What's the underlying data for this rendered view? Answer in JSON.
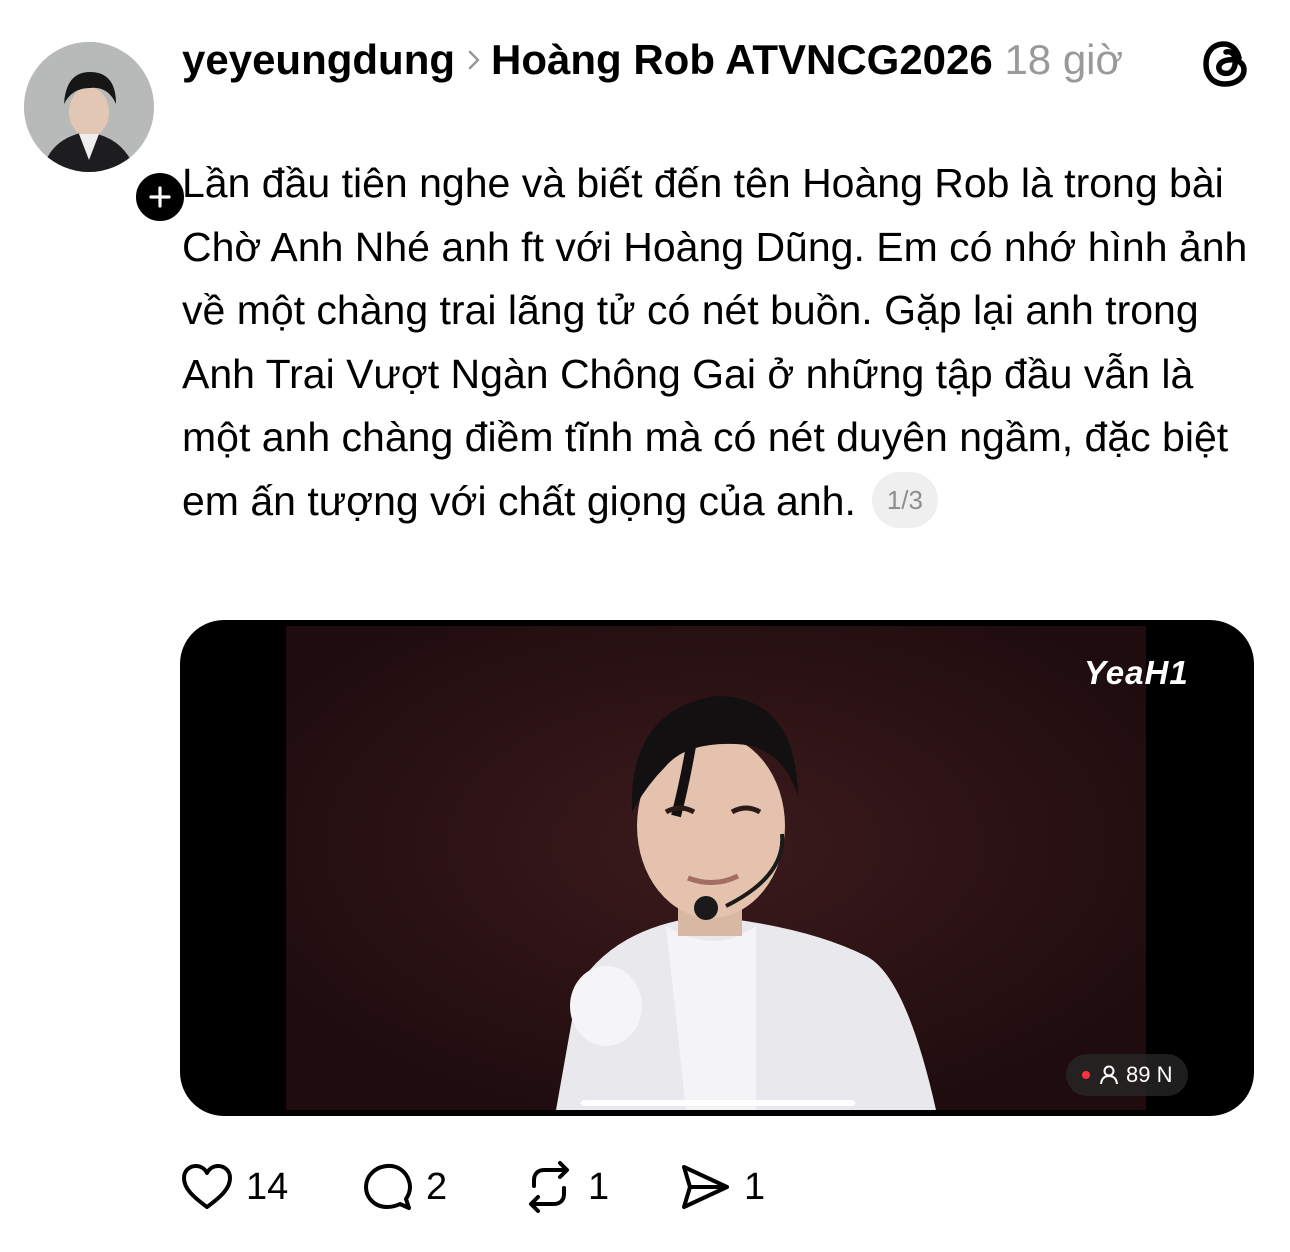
{
  "post": {
    "username": "yeyeungdung",
    "community": "Hoàng Rob ATVNCG2026",
    "timestamp": "18 giờ",
    "text": "Lần đầu tiên nghe và biết đến tên Hoàng Rob là trong bài Chờ Anh Nhé anh ft với Hoàng Dũng. Em có nhớ hình ảnh về một chàng trai lãng tử có nét buồn. Gặp lại anh trong Anh Trai Vượt Ngàn Chông Gai ở những tập đầu vẫn là một anh chàng điềm tĩnh mà có nét duyên ngầm, đặc biệt em ấn tượng với chất giọng của anh.",
    "page_indicator": "1/3"
  },
  "video": {
    "brand": "YeaH1",
    "viewers": "89 N",
    "progress": 1.0
  },
  "actions": {
    "likes": "14",
    "replies": "2",
    "reposts": "1",
    "shares": "1"
  },
  "icons": {
    "follow": "plus-icon",
    "app_logo": "threads-logo-icon",
    "breadcrumb": "chevron-right-icon",
    "like": "heart-icon",
    "reply": "comment-icon",
    "repost": "repost-icon",
    "share": "send-icon",
    "viewer": "person-icon"
  },
  "colors": {
    "text": "#000000",
    "muted": "#999999",
    "live_dot": "#ff3040",
    "video_bg": "#2b1214"
  }
}
